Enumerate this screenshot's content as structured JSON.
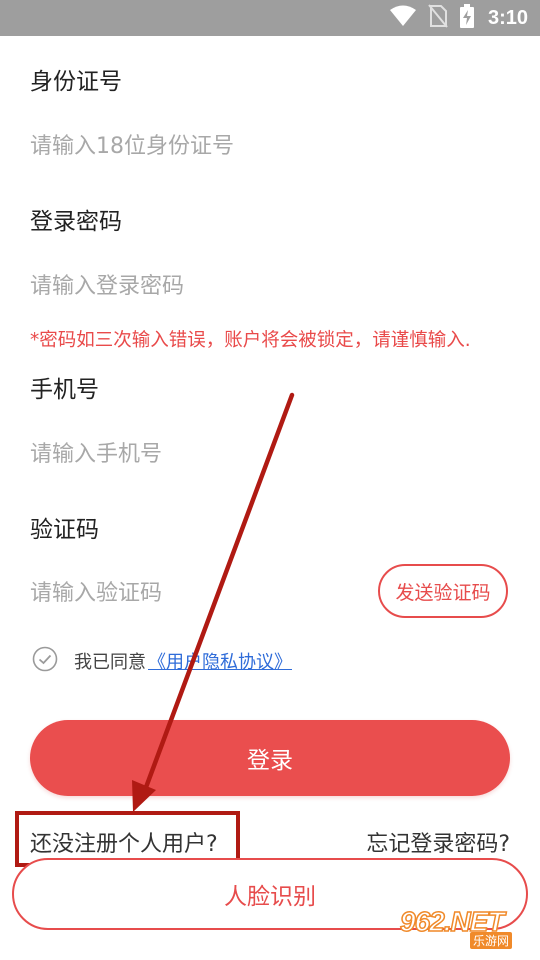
{
  "status_bar": {
    "time": "3:10",
    "icons": [
      "wifi-icon",
      "no-sim-icon",
      "battery-charging-icon"
    ]
  },
  "form": {
    "id_label": "身份证号",
    "id_placeholder": "请输入18位身份证号",
    "password_label": "登录密码",
    "password_placeholder": "请输入登录密码",
    "password_warning": "*密码如三次输入错误，账户将会被锁定，请谨慎输入.",
    "phone_label": "手机号",
    "phone_placeholder": "请输入手机号",
    "code_label": "验证码",
    "code_placeholder": "请输入验证码",
    "send_code_button": "发送验证码"
  },
  "agreement": {
    "text": "我已同意",
    "link": "《用户隐私协议》",
    "checked": false
  },
  "buttons": {
    "login": "登录",
    "face_recognition": "人脸识别"
  },
  "links": {
    "register": "还没注册个人用户?",
    "forgot_password": "忘记登录密码?"
  },
  "watermark": {
    "logo_text": "962.NET",
    "subtitle": "乐游网"
  },
  "colors": {
    "accent": "#ea4e4e",
    "annotation": "#b01a13",
    "link": "#2f6cd9",
    "status_bar": "#9e9e9e"
  }
}
